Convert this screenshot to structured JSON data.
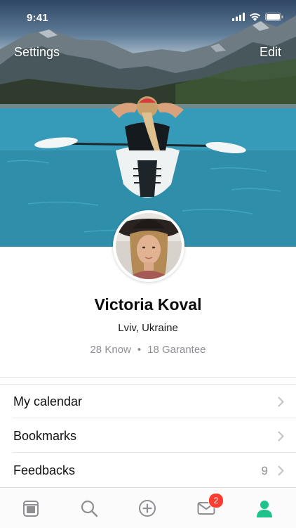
{
  "status_bar": {
    "time": "9:41"
  },
  "nav": {
    "left_label": "Settings",
    "right_label": "Edit"
  },
  "profile": {
    "name": "Victoria Koval",
    "location": "Lviv, Ukraine",
    "stats": [
      {
        "value": "28",
        "label": "Know"
      },
      {
        "value": "18",
        "label": "Garantee"
      }
    ]
  },
  "menu": {
    "items": [
      {
        "label": "My calendar",
        "count": ""
      },
      {
        "label": "Bookmarks",
        "count": ""
      },
      {
        "label": "Feedbacks",
        "count": "9"
      }
    ]
  },
  "tabbar": {
    "items": [
      {
        "icon": "calendar-icon",
        "active": false
      },
      {
        "icon": "search-icon",
        "active": false
      },
      {
        "icon": "add-icon",
        "active": false
      },
      {
        "icon": "mail-icon",
        "active": false,
        "badge": "2"
      },
      {
        "icon": "profile-icon",
        "active": true
      }
    ]
  },
  "colors": {
    "accent": "#1fc28a",
    "tab_inactive": "#8e8e93",
    "badge": "#ff3b30",
    "secondary_text": "#8e8e93"
  }
}
